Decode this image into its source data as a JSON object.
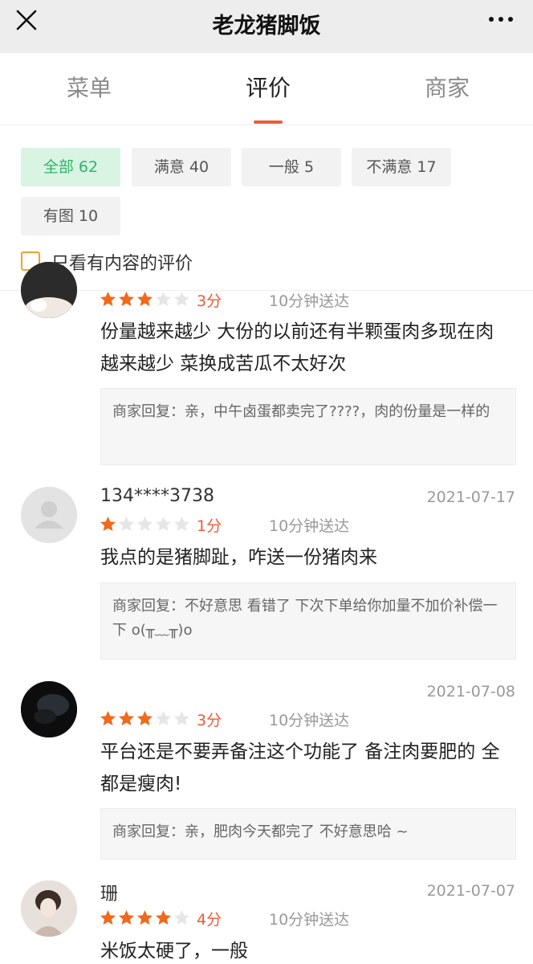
{
  "header": {
    "title": "老龙猪脚饭",
    "close_icon": "close-icon",
    "more_icon": "more-dots-icon"
  },
  "tabs": [
    {
      "label": "菜单",
      "active": false
    },
    {
      "label": "评价",
      "active": true
    },
    {
      "label": "商家",
      "active": false
    }
  ],
  "filters": {
    "chips": [
      {
        "label": "全部 62",
        "active": true
      },
      {
        "label": "满意 40",
        "active": false
      },
      {
        "label": "一般 5",
        "active": false
      },
      {
        "label": "不满意 17",
        "active": false
      },
      {
        "label": "有图 10",
        "active": false
      }
    ],
    "content_only_label": "只看有内容的评价",
    "content_only_checked": false
  },
  "reviews": [
    {
      "username": "",
      "date": "",
      "rating": 3,
      "score_label": "3分",
      "delivery": "10分钟送达",
      "content": "份量越来越少 大份的以前还有半颗蛋肉多现在肉 越来越少 菜换成苦瓜不太好次",
      "reply": "商家回复：亲，中午卤蛋都卖完了????，肉的份量是一样的"
    },
    {
      "username": "134****3738",
      "date": "2021-07-17",
      "rating": 1,
      "score_label": "1分",
      "delivery": "10分钟送达",
      "content": "我点的是猪脚趾，咋送一份猪肉来",
      "reply": "商家回复：不好意思 看错了 下次下单给你加量不加价补偿一下 o(╥﹏╥)o"
    },
    {
      "username": "",
      "date": "2021-07-08",
      "rating": 3,
      "score_label": "3分",
      "delivery": "10分钟送达",
      "content": "平台还是不要弄备注这个功能了 备注肉要肥的 全都是瘦肉!",
      "reply": "商家回复：亲，肥肉今天都完了 不好意思哈 ~"
    },
    {
      "username": "珊",
      "date": "2021-07-07",
      "rating": 4,
      "score_label": "4分",
      "delivery": "10分钟送达",
      "content": "米饭太硬了，一般",
      "reply": ""
    }
  ],
  "colors": {
    "accent": "#ee5a3a",
    "star_on": "#f06a1e",
    "star_off": "#e6e6e6",
    "chip_active_bg": "#d9f4e3",
    "chip_active_text": "#2fb36a",
    "checkbox_border": "#f0a22e"
  }
}
